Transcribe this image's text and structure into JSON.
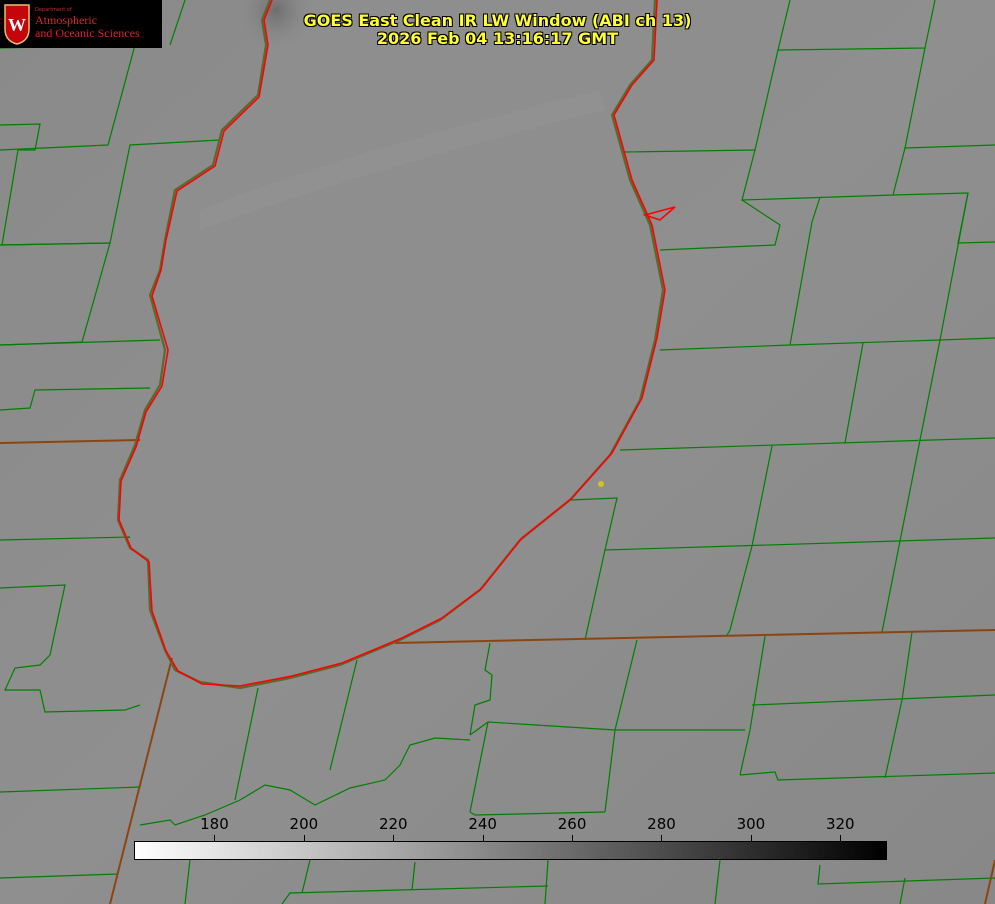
{
  "title": {
    "line1": "GOES East Clean IR LW Window (ABI ch 13)",
    "line2": "2026 Feb 04 13:16:17 GMT"
  },
  "logo": {
    "department": "Department of",
    "line1": "Atmospheric",
    "line2": "and Oceanic Sciences",
    "crest_letter": "W"
  },
  "colorbar": {
    "ticks": [
      "180",
      "200",
      "220",
      "240",
      "260",
      "280",
      "300",
      "320"
    ],
    "min_value": 162,
    "max_value": 330,
    "gradient": [
      "#ffffff",
      "#000000"
    ]
  },
  "colors": {
    "title": "#ffff33",
    "county_lines": "#008000",
    "state_lines": "#8b4513",
    "lake_outline": "#ff0000",
    "marker": "#d4c21a",
    "land": "#8d8d8d"
  }
}
